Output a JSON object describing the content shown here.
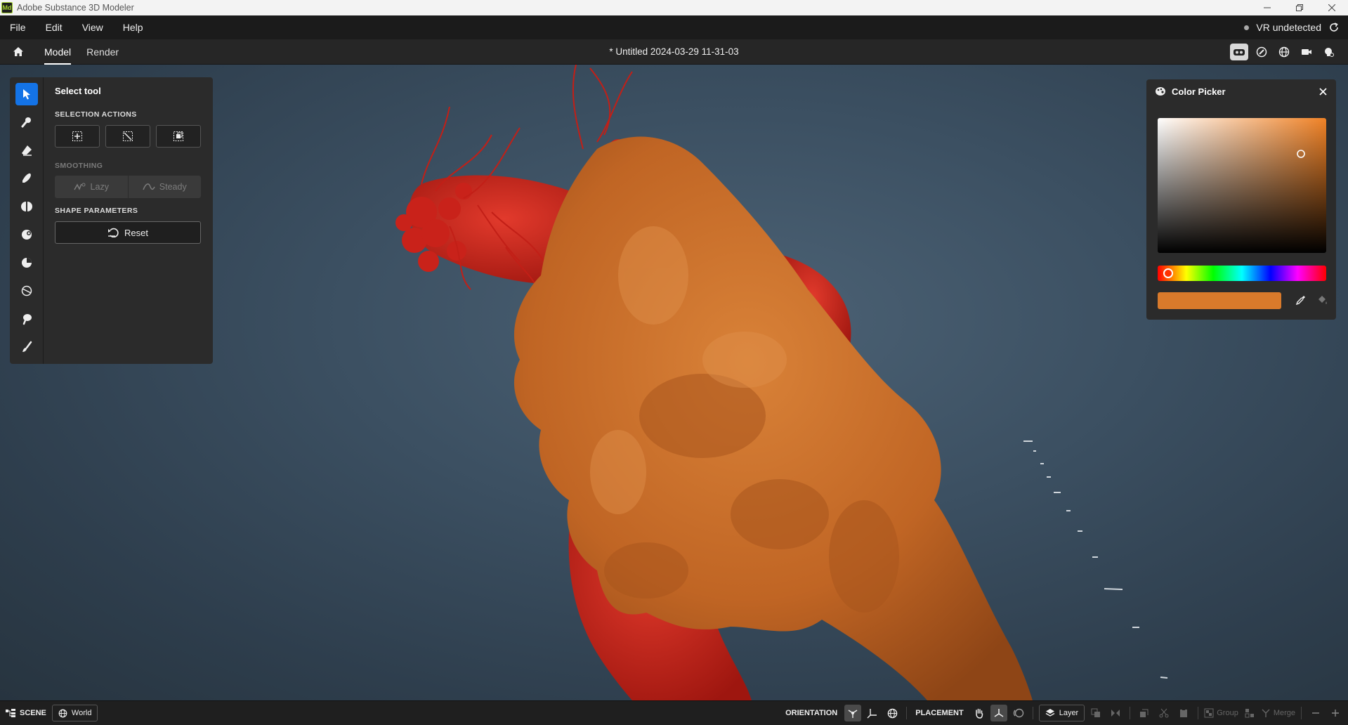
{
  "app": {
    "title": "Adobe Substance 3D Modeler",
    "logo_text": "Md"
  },
  "menu": {
    "items": [
      "File",
      "Edit",
      "View",
      "Help"
    ],
    "vr_status": "VR undetected"
  },
  "tabs": {
    "items": [
      "Model",
      "Render"
    ],
    "active": "Model",
    "document_title": "*  Untitled 2024-03-29 11-31-03"
  },
  "tool_panel": {
    "title": "Select tool",
    "selection_actions_label": "SELECTION ACTIONS",
    "smoothing_label": "SMOOTHING",
    "smoothing_options": [
      "Lazy",
      "Steady"
    ],
    "shape_parameters_label": "SHAPE PARAMETERS",
    "reset_label": "Reset",
    "tools": [
      "select-tool",
      "clay-tool",
      "erase-tool",
      "smooth-tool",
      "move-tool",
      "inflate-tool",
      "flatten-tool",
      "cut-tool",
      "stamp-tool",
      "paint-tool"
    ]
  },
  "color_picker": {
    "title": "Color Picker",
    "current_color": "#d97a2b",
    "base_hue": "#f08226"
  },
  "bottom_bar": {
    "scene_label": "SCENE",
    "world_label": "World",
    "orientation_label": "ORIENTATION",
    "placement_label": "PLACEMENT",
    "layer_label": "Layer",
    "group_label": "Group",
    "merge_label": "Merge"
  },
  "colors": {
    "accent": "#1473e6",
    "sculpt_orange": "#c86d2a",
    "sculpt_red": "#cc2219"
  }
}
